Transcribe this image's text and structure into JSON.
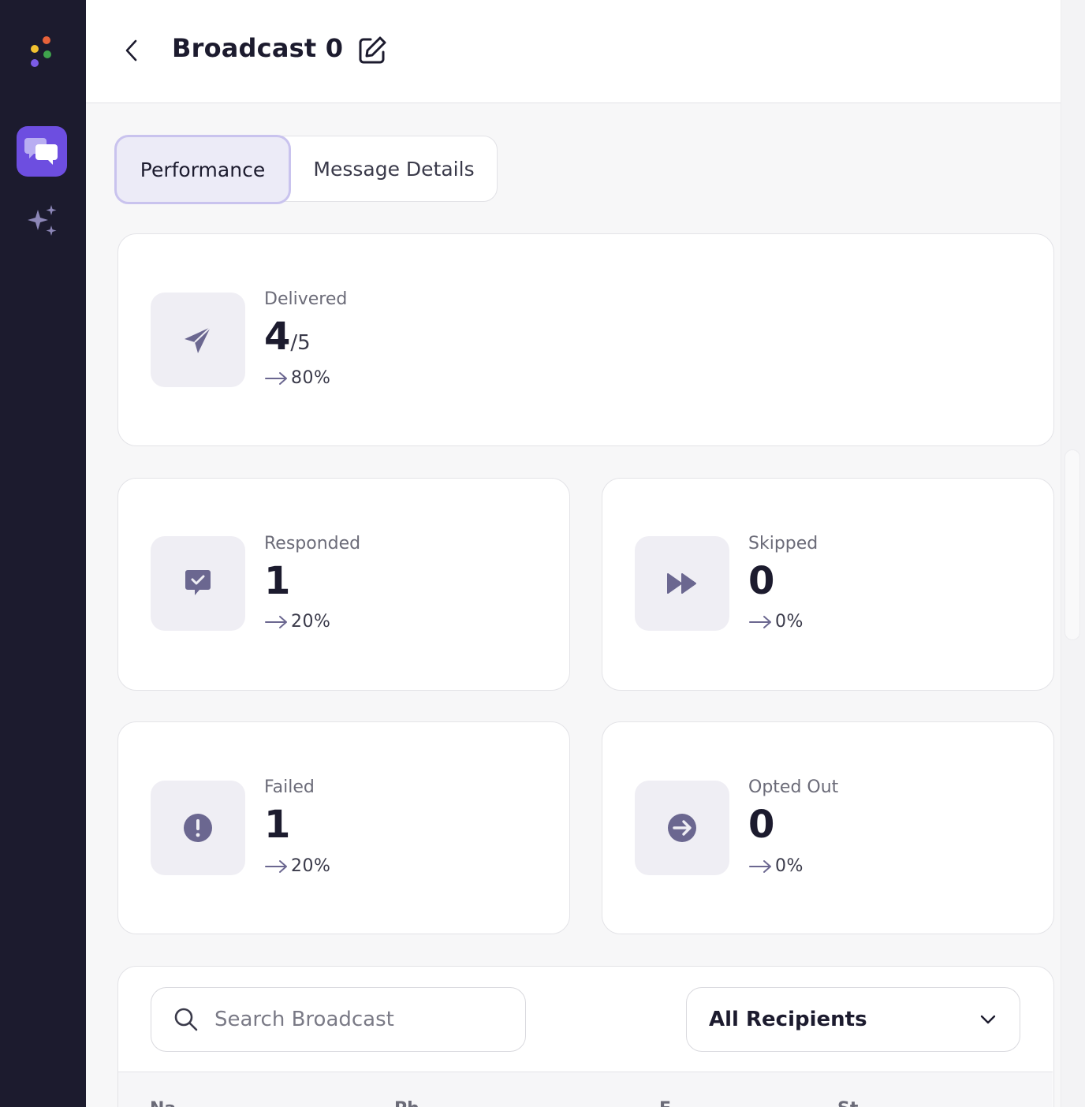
{
  "header": {
    "title": "Broadcast 0"
  },
  "tabs": [
    {
      "label": "Performance",
      "active": true
    },
    {
      "label": "Message Details",
      "active": false
    }
  ],
  "stats": {
    "delivered": {
      "label": "Delivered",
      "value": "4",
      "total": "/5",
      "pct": "80%",
      "icon": "paper-plane-icon"
    },
    "responded": {
      "label": "Responded",
      "value": "1",
      "pct": "20%",
      "icon": "chat-check-icon"
    },
    "skipped": {
      "label": "Skipped",
      "value": "0",
      "pct": "0%",
      "icon": "fast-forward-icon"
    },
    "failed": {
      "label": "Failed",
      "value": "1",
      "pct": "20%",
      "icon": "exclamation-icon"
    },
    "opted_out": {
      "label": "Opted Out",
      "value": "0",
      "pct": "0%",
      "icon": "arrow-right-circle-icon"
    }
  },
  "recipients": {
    "search_placeholder": "Search Broadcast",
    "filter_value": "All Recipients",
    "columns": [
      "Na",
      "Ph",
      "E",
      "St"
    ]
  },
  "colors": {
    "sidebar": "#1c1b2e",
    "accent": "#6d4ee0",
    "icon": "#6b6790",
    "active_tab_bg": "#ecebf7",
    "active_tab_border": "#c9c3ee"
  }
}
